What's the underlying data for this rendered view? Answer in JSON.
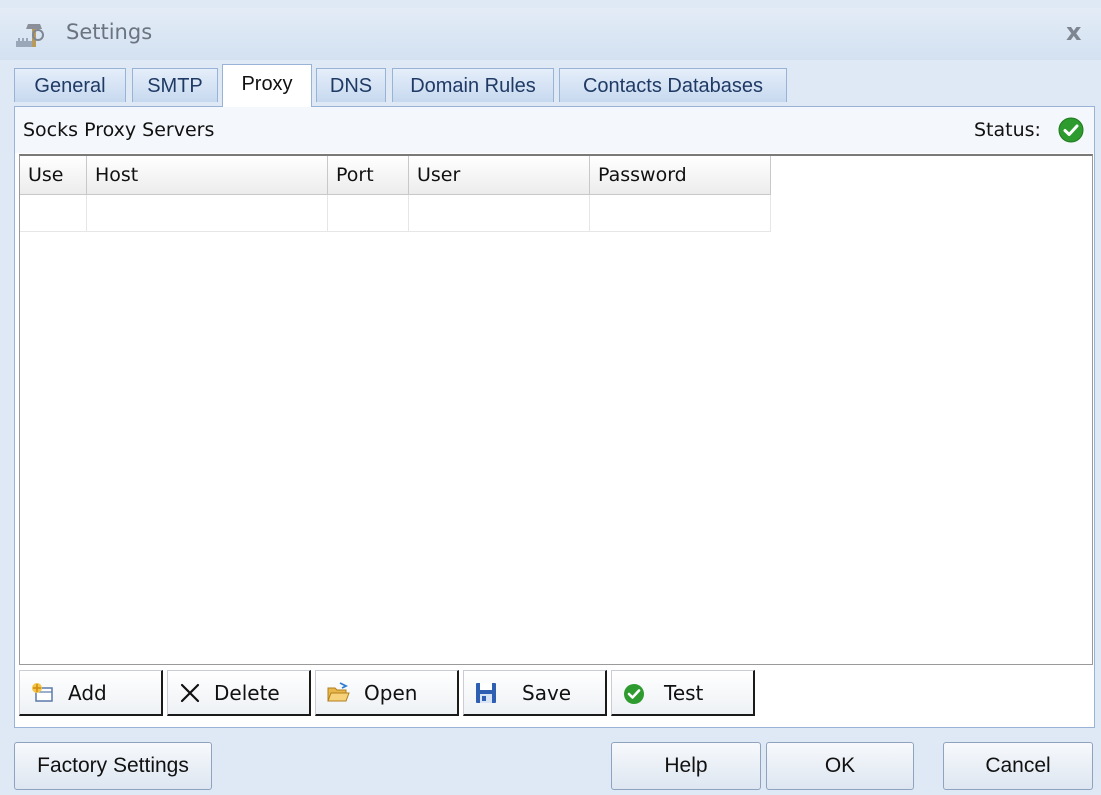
{
  "window": {
    "title": "Settings",
    "close_glyph": "x"
  },
  "tabs": [
    {
      "label": "General"
    },
    {
      "label": "SMTP"
    },
    {
      "label": "Proxy",
      "active": true
    },
    {
      "label": "DNS"
    },
    {
      "label": "Domain Rules"
    },
    {
      "label": "Contacts Databases"
    }
  ],
  "panel": {
    "title": "Socks Proxy Servers",
    "status_label": "Status:",
    "status_icon": "check-circle-icon",
    "status_color": "#2e9b2e"
  },
  "grid": {
    "columns": [
      "Use",
      "Host",
      "Port",
      "User",
      "Password"
    ],
    "rows": [
      [
        "",
        "",
        "",
        "",
        ""
      ]
    ]
  },
  "toolbar": {
    "add": "Add",
    "delete": "Delete",
    "open": "Open",
    "save": "Save",
    "test": "Test"
  },
  "footer": {
    "factory": "Factory Settings",
    "help": "Help",
    "ok": "OK",
    "cancel": "Cancel"
  },
  "colors": {
    "accent_border": "#98b3d6",
    "window_bg": "#dfe9f5"
  }
}
